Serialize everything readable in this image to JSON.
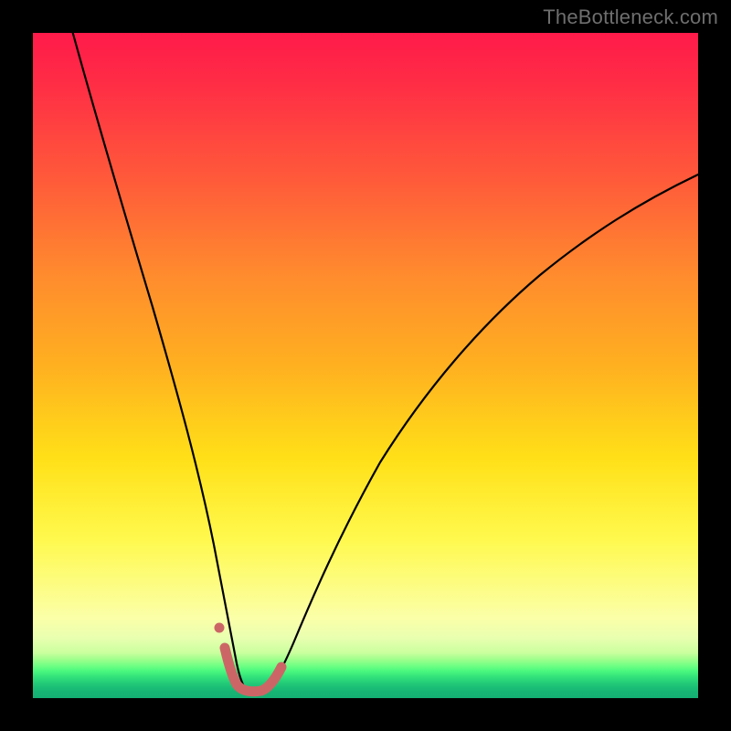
{
  "watermark": "TheBottleneck.com",
  "chart_data": {
    "type": "line",
    "title": "",
    "xlabel": "",
    "ylabel": "",
    "xlim": [
      0,
      1
    ],
    "ylim": [
      0,
      1
    ],
    "series": [
      {
        "name": "main-curve",
        "x": [
          0.06,
          0.09,
          0.12,
          0.15,
          0.18,
          0.21,
          0.24,
          0.26,
          0.28,
          0.3,
          0.32,
          0.34,
          0.36,
          0.4,
          0.44,
          0.5,
          0.56,
          0.64,
          0.72,
          0.8,
          0.88,
          0.96,
          1.0
        ],
        "y": [
          1.0,
          0.88,
          0.76,
          0.63,
          0.5,
          0.37,
          0.23,
          0.14,
          0.07,
          0.025,
          0.01,
          0.015,
          0.035,
          0.11,
          0.2,
          0.33,
          0.44,
          0.56,
          0.65,
          0.72,
          0.775,
          0.815,
          0.83
        ]
      },
      {
        "name": "highlight-segment",
        "x": [
          0.275,
          0.285,
          0.295,
          0.305,
          0.32,
          0.34,
          0.36
        ],
        "y": [
          0.087,
          0.045,
          0.02,
          0.012,
          0.01,
          0.015,
          0.035
        ]
      },
      {
        "name": "highlight-dot",
        "x": [
          0.268
        ],
        "y": [
          0.118
        ]
      }
    ],
    "colors": {
      "curve": "#000000",
      "highlight": "#cc6666"
    }
  }
}
